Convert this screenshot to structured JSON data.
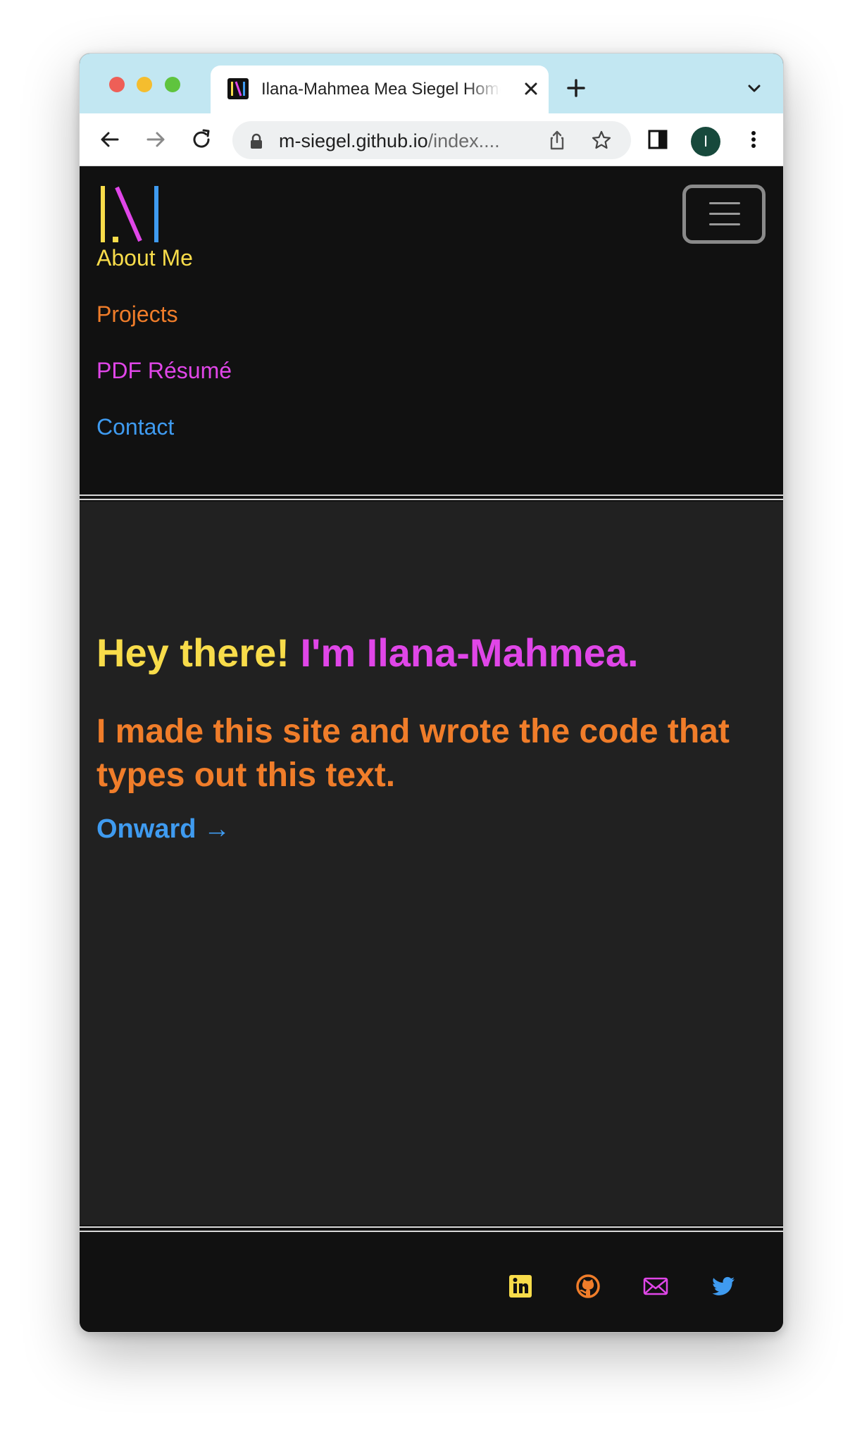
{
  "browser": {
    "tab_title": "Ilana-Mahmea Mea Siegel Homepage",
    "url_host": "m-siegel.github.io",
    "url_path": "/index....",
    "profile_initial": "I"
  },
  "nav": {
    "links": [
      "About Me",
      "Projects",
      "PDF Résumé",
      "Contact"
    ]
  },
  "hero": {
    "greeting_part1": "Hey there!",
    "greeting_part2": "I'm Ilana-Mahmea.",
    "subtitle": "I made this site and wrote the code that types out this text.",
    "onward": "Onward →"
  },
  "footer": {
    "icons": [
      "linkedin-icon",
      "github-icon",
      "email-icon",
      "twitter-icon"
    ]
  },
  "colors": {
    "yellow": "#f8dc4a",
    "orange": "#f07d2a",
    "magenta": "#e046e8",
    "blue": "#3f9bf0",
    "nav_bg": "#111111",
    "hero_bg": "#212121",
    "tabstrip_bg": "#c2e7f2"
  }
}
